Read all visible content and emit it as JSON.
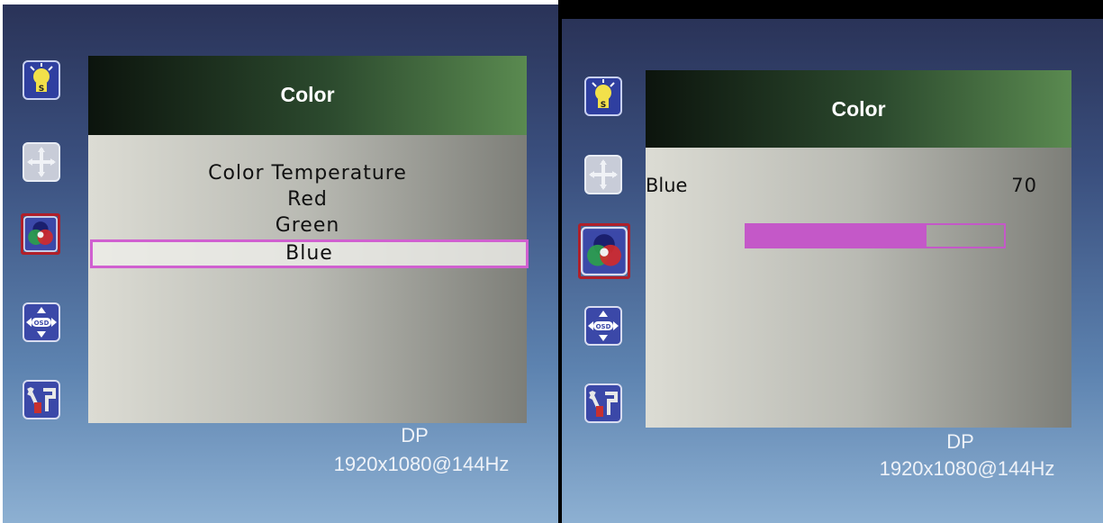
{
  "left_screen": {
    "menu_title": "Color",
    "menu_items": [
      "Color Temperature",
      "Red",
      "Green",
      "Blue"
    ],
    "selected_item": "Blue",
    "status": {
      "input": "DP",
      "resolution": "1920x1080@144Hz"
    }
  },
  "right_screen": {
    "menu_title": "Color",
    "setting": {
      "label": "Blue",
      "value": "70",
      "level_percent": 70
    },
    "status": {
      "input": "DP",
      "resolution": "1920x1080@144Hz"
    }
  },
  "sidebar_icons": [
    "brightness-icon",
    "position-icon",
    "color-icon",
    "osd-settings-icon",
    "tools-icon"
  ],
  "selected_icon": "color-icon",
  "colors": {
    "selection_border": "#d060d0",
    "slider_fill": "#c458c8",
    "icon_selection": "#b0202a"
  }
}
